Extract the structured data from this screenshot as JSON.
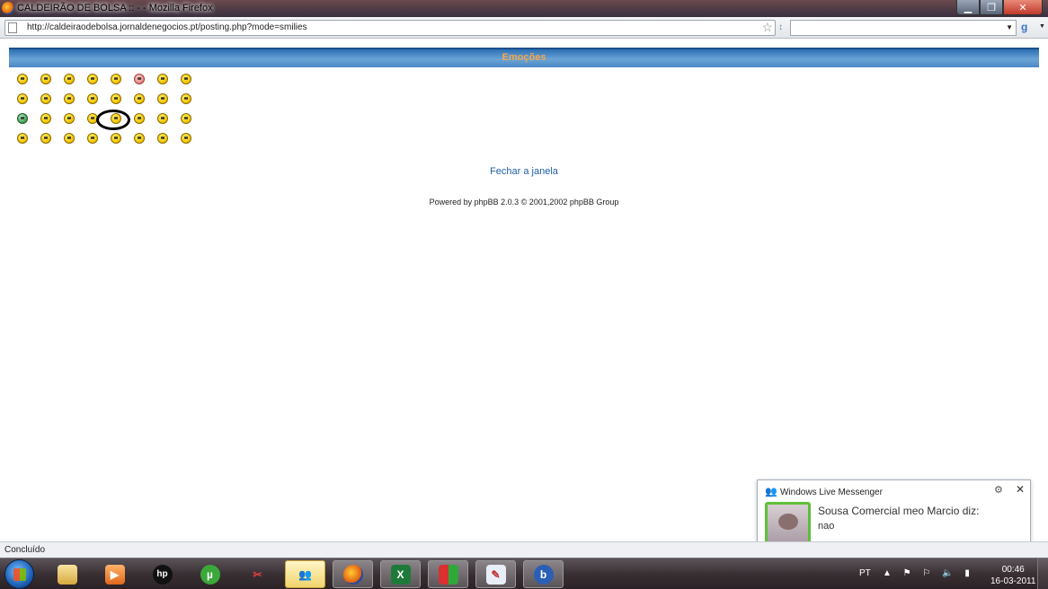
{
  "window": {
    "title": "CALDEIRÃO DE BOLSA :: - - Mozilla Firefox",
    "controls": {
      "minimize": "▁",
      "maximize": "❐",
      "close": "✕"
    }
  },
  "navigation": {
    "url": "http://caldeiraodebolsa.jornaldenegocios.pt/posting.php?mode=smilies",
    "search_placeholder": ""
  },
  "page": {
    "header_title": "Emoções",
    "smilies_rows": 4,
    "smilies_cols": 8,
    "close_link": "Fechar a janela",
    "powered_by": "Powered by phpBB 2.0.3 © 2001,2002 phpBB Group"
  },
  "messenger": {
    "app_name": "Windows Live Messenger",
    "sender": "Sousa Comercial meo Marcio diz:",
    "message": "nao"
  },
  "status_bar": {
    "text": "Concluído"
  },
  "taskbar": {
    "language": "PT",
    "time": "00:46",
    "date": "16-03-2011",
    "apps": [
      "explorer-icon",
      "media-player-icon",
      "hp-icon",
      "utorrent-icon",
      "snipping-tool-icon",
      "messenger-icon",
      "firefox-icon",
      "excel-icon",
      "chart-app-icon",
      "paint-icon",
      "bing-icon"
    ],
    "hp_label": "hp"
  },
  "colors": {
    "header_bar": "#4b87c3",
    "header_text": "#f5a74c",
    "link": "#1f5fa6",
    "highlight_circle": "#000000"
  }
}
